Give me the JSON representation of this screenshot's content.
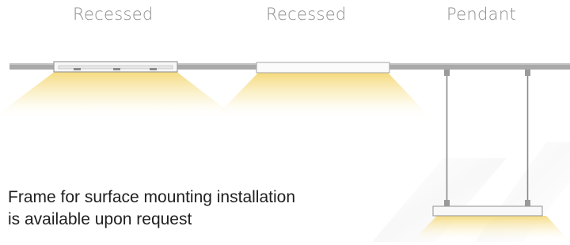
{
  "labels": {
    "recessed_1": "Recessed",
    "recessed_2": "Recessed",
    "pendant": "Pendant"
  },
  "note": {
    "line_1": "Frame for surface mounting installation",
    "line_2": "is available upon request"
  },
  "colors": {
    "ceiling": "#a9a9a9",
    "label_text": "#8d8d8d",
    "note_text": "#1f1f1f",
    "light_glow": "#f4d774",
    "fixture_frame": "#9b9b9b",
    "fixture_panel": "#f7f7f7",
    "suspension_wire": "#8a8a8a"
  }
}
